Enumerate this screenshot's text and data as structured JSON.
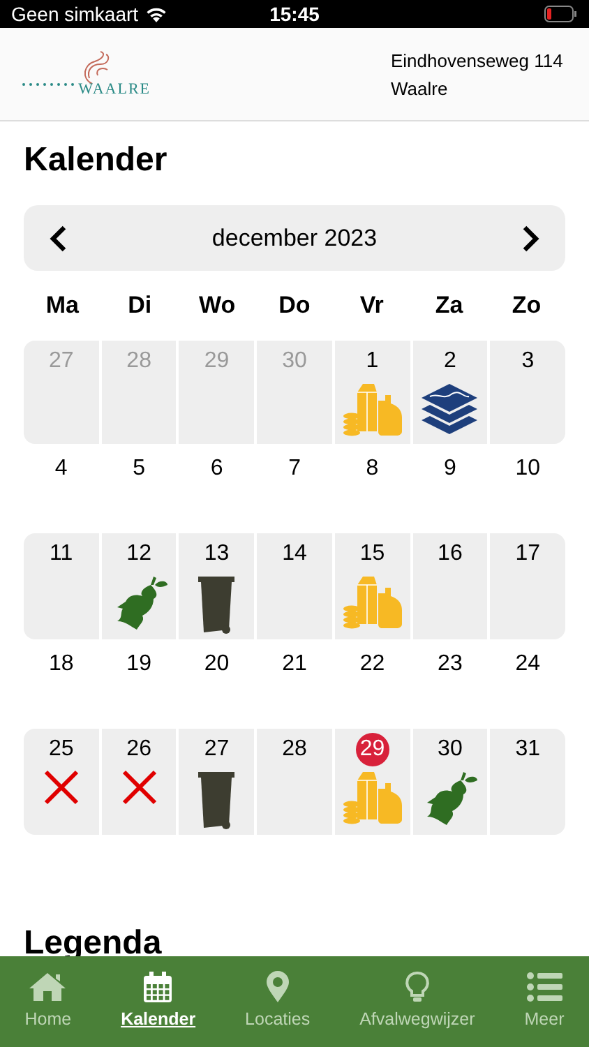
{
  "status_bar": {
    "carrier": "Geen simkaart",
    "time": "15:45"
  },
  "header": {
    "logo_text": "WAALRE",
    "address_lines": [
      "Eindhovenseweg 114",
      "Waalre"
    ]
  },
  "title": "Kalender",
  "month_nav": {
    "month": "december 2023"
  },
  "weekdays": [
    "Ma",
    "Di",
    "Wo",
    "Do",
    "Vr",
    "Za",
    "Zo"
  ],
  "weeks": [
    [
      {
        "day": "27",
        "muted": true,
        "today": false
      },
      {
        "day": "28",
        "muted": true,
        "today": false
      },
      {
        "day": "29",
        "muted": true,
        "today": false
      },
      {
        "day": "30",
        "muted": true,
        "today": false
      },
      {
        "day": "1",
        "muted": false,
        "today": false,
        "kind": "pmd"
      },
      {
        "day": "2",
        "muted": false,
        "today": false,
        "kind": "paper"
      },
      {
        "day": "3",
        "muted": false,
        "today": false
      }
    ],
    [
      {
        "day": "4",
        "muted": false,
        "today": false
      },
      {
        "day": "5",
        "muted": false,
        "today": false
      },
      {
        "day": "6",
        "muted": false,
        "today": false
      },
      {
        "day": "7",
        "muted": false,
        "today": false
      },
      {
        "day": "8",
        "muted": false,
        "today": false
      },
      {
        "day": "9",
        "muted": false,
        "today": false
      },
      {
        "day": "10",
        "muted": false,
        "today": false
      }
    ],
    [
      {
        "day": "11",
        "muted": false,
        "today": false
      },
      {
        "day": "12",
        "muted": false,
        "today": false,
        "kind": "organic"
      },
      {
        "day": "13",
        "muted": false,
        "today": false,
        "kind": "residual"
      },
      {
        "day": "14",
        "muted": false,
        "today": false
      },
      {
        "day": "15",
        "muted": false,
        "today": false,
        "kind": "pmd"
      },
      {
        "day": "16",
        "muted": false,
        "today": false
      },
      {
        "day": "17",
        "muted": false,
        "today": false
      }
    ],
    [
      {
        "day": "18",
        "muted": false,
        "today": false
      },
      {
        "day": "19",
        "muted": false,
        "today": false
      },
      {
        "day": "20",
        "muted": false,
        "today": false
      },
      {
        "day": "21",
        "muted": false,
        "today": false
      },
      {
        "day": "22",
        "muted": false,
        "today": false
      },
      {
        "day": "23",
        "muted": false,
        "today": false
      },
      {
        "day": "24",
        "muted": false,
        "today": false
      }
    ],
    [
      {
        "day": "25",
        "muted": false,
        "today": false,
        "kind": "cancelled"
      },
      {
        "day": "26",
        "muted": false,
        "today": false,
        "kind": "cancelled"
      },
      {
        "day": "27",
        "muted": false,
        "today": false,
        "kind": "residual"
      },
      {
        "day": "28",
        "muted": false,
        "today": false
      },
      {
        "day": "29",
        "muted": false,
        "today": true,
        "kind": "pmd"
      },
      {
        "day": "30",
        "muted": false,
        "today": false,
        "kind": "organic"
      },
      {
        "day": "31",
        "muted": false,
        "today": false
      }
    ]
  ],
  "section_heading": "Legenda",
  "tab_bar": [
    {
      "label": "Home",
      "selected": false
    },
    {
      "label": "Kalender",
      "selected": true
    },
    {
      "label": "Locaties",
      "selected": false
    },
    {
      "label": "Afvalwegwijzer",
      "selected": false
    },
    {
      "label": "Meer",
      "selected": false
    }
  ]
}
